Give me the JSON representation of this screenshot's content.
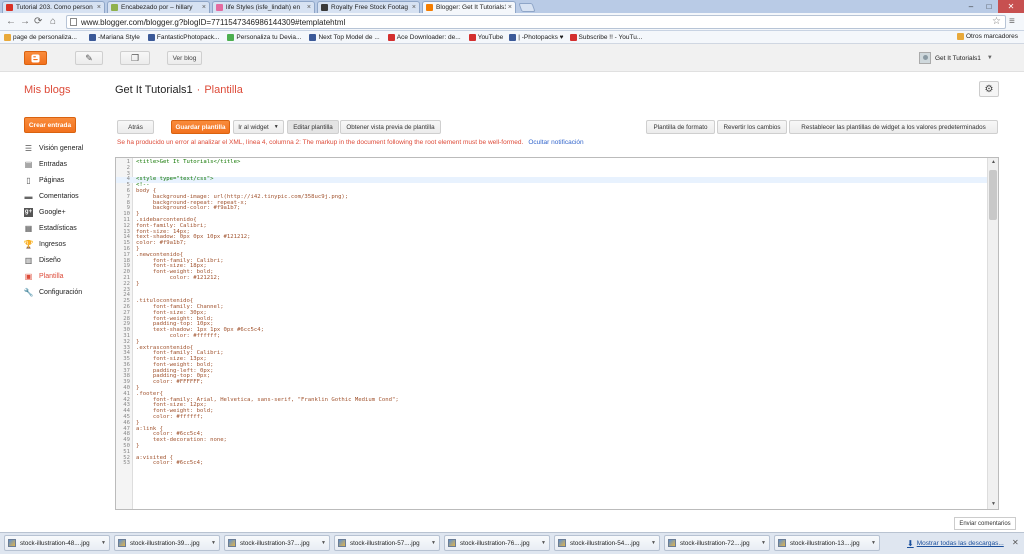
{
  "browser": {
    "tabs": [
      {
        "title": "Tutorial 203. Como person",
        "icon_color": "#d93025",
        "active": false
      },
      {
        "title": "Encabezado por – hillary",
        "icon_color": "#8fb14c",
        "active": false
      },
      {
        "title": "life Styles (isfe_lindah) en",
        "icon_color": "#e46aa0",
        "active": false
      },
      {
        "title": "Royalty Free Stock Footag",
        "icon_color": "#3a3a3a",
        "active": false
      },
      {
        "title": "Blogger: Get It Tutorials1",
        "icon_color": "#f57d00",
        "active": true
      }
    ],
    "url": "www.blogger.com/blogger.g?blogID=7711547346986144309#templatehtml",
    "bookmarks": [
      {
        "label": "page de personaliza...",
        "icon_color": "#e8a93b"
      },
      {
        "label": "-Mariana Style",
        "icon_color": "#3b5998"
      },
      {
        "label": "FantasticPhotopack...",
        "icon_color": "#3b5998"
      },
      {
        "label": "Personaliza tu Devia...",
        "icon_color": "#4caf50"
      },
      {
        "label": "Next Top Model de ...",
        "icon_color": "#3b5998"
      },
      {
        "label": "Ace Downloader: de...",
        "icon_color": "#d32f2f"
      },
      {
        "label": "YouTube",
        "icon_color": "#d32f2f"
      },
      {
        "label": "| -Photopacks ♥",
        "icon_color": "#3b5998"
      },
      {
        "label": "Subscribe !! - YouTu...",
        "icon_color": "#d32f2f"
      }
    ],
    "other_bookmarks": "Otros marcadores"
  },
  "header": {
    "ver_blog": "Ver blog",
    "user_name": "Get It Tutorials1"
  },
  "title": {
    "mis_blogs": "Mis blogs",
    "blog_name": "Get It Tutorials1",
    "separator": "·",
    "section": "Plantilla"
  },
  "sidebar": {
    "create_label": "Crear entrada",
    "items": [
      {
        "label": "Visión general",
        "icon": "list-icon"
      },
      {
        "label": "Entradas",
        "icon": "posts-icon"
      },
      {
        "label": "Páginas",
        "icon": "page-icon"
      },
      {
        "label": "Comentarios",
        "icon": "comment-icon"
      },
      {
        "label": "Google+",
        "icon": "google-plus-icon"
      },
      {
        "label": "Estadísticas",
        "icon": "stats-icon"
      },
      {
        "label": "Ingresos",
        "icon": "trophy-icon"
      },
      {
        "label": "Diseño",
        "icon": "layout-icon"
      },
      {
        "label": "Plantilla",
        "icon": "template-icon",
        "active": true
      },
      {
        "label": "Configuración",
        "icon": "wrench-icon"
      }
    ]
  },
  "actions": {
    "atras": "Atrás",
    "guardar": "Guardar plantilla",
    "ir_widget": "Ir al widget",
    "editar": "Editar plantilla",
    "vista_previa": "Obtener vista previa de plantilla",
    "formato": "Plantilla de formato",
    "revertir": "Revertir los cambios",
    "restablecer": "Restablecer las plantillas de widget a los valores predeterminados"
  },
  "error": {
    "message": "Se ha producido un error al analizar el XML, línea 4, columna 2: The markup in the document following the root element must be well-formed.",
    "link": "Ocultar notificación"
  },
  "editor": {
    "lines": [
      "<title>Get It Tutorials</title>",
      "",
      "",
      "<style type=\"text/css\">",
      "<!--",
      "body {",
      "     background-image: url(http://i42.tinypic.com/358uc9j.png);",
      "     background-repeat: repeat-x;",
      "     background-color: #f9a1b7;",
      "}",
      ".sidebarcontenido{",
      "font-family: Calibri;",
      "font-size: 14px;",
      "text-shadow: 0px 0px 10px #121212;",
      "color: #f9a1b7;",
      "}",
      ".newcontenido{",
      "     font-family: Calibri;",
      "     font-size: 18px;",
      "     font-weight: bold;",
      "          color: #121212;",
      "}",
      "",
      "",
      ".titulocontenido{",
      "     font-family: Channel;",
      "     font-size: 30px;",
      "     font-weight: bold;",
      "     padding-top: 10px;",
      "     text-shadow: 1px 1px 0px #6cc5c4;",
      "          color: #ffffff;",
      "}",
      ".extrascontenido{",
      "     font-family: Calibri;",
      "     font-size: 13px;",
      "     font-weight: bold;",
      "     padding-left: 0px;",
      "     padding-top: 0px;",
      "     color: #FFFFFF;",
      "}",
      ".footer{",
      "     font-family: Arial, Helvetica, sans-serif, \"Franklin Gothic Medium Cond\";",
      "     font-size: 12px;",
      "     font-weight: bold;",
      "     color: #ffffff;",
      "}",
      "a:link {",
      "     color: #6cc5c4;",
      "     text-decoration: none;",
      "}",
      "",
      "a:visited {",
      "     color: #6cc5c4;"
    ],
    "highlight_line": 4
  },
  "feedback": "Enviar comentarios",
  "downloads": {
    "items": [
      "stock-illustration-48....jpg",
      "stock-illustration-39....jpg",
      "stock-illustration-37....jpg",
      "stock-illustration-57....jpg",
      "stock-illustration-76....jpg",
      "stock-illustration-54....jpg",
      "stock-illustration-72....jpg",
      "stock-illustration-13....jpg"
    ],
    "show_all": "Mostrar todas las descargas..."
  },
  "colors": {
    "accent": "#f2711e",
    "accent_text": "#dd4b39",
    "link": "#3366cc"
  }
}
